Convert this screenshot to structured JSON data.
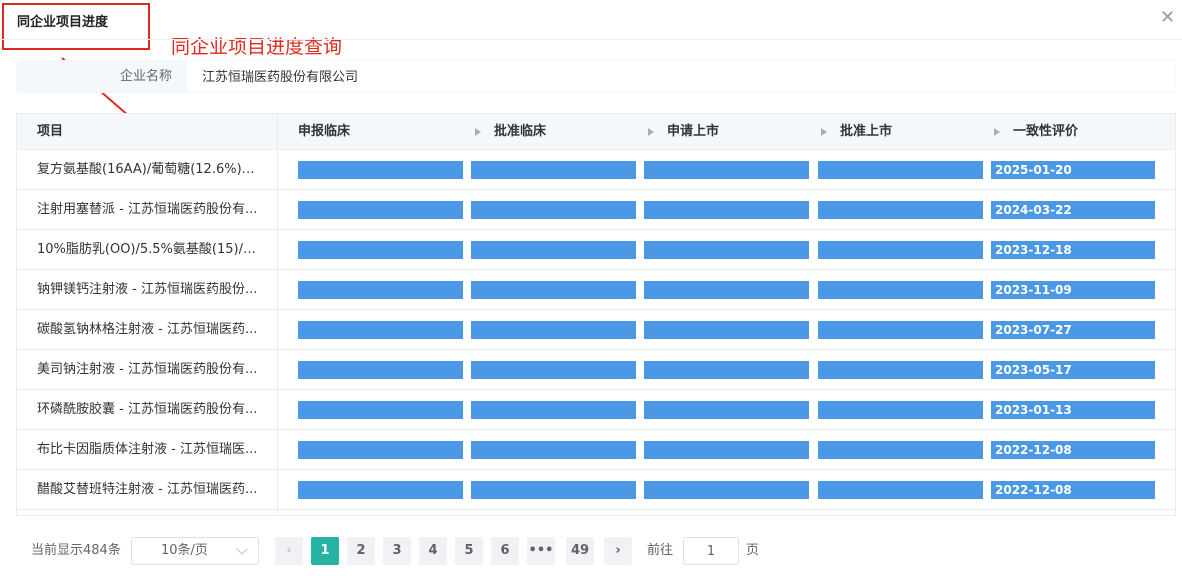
{
  "dialog": {
    "title": "同企业项目进度",
    "close_glyph": "✕",
    "annotation": "同企业项目进度查询"
  },
  "company": {
    "label": "企业名称",
    "value": "江苏恒瑞医药股份有限公司"
  },
  "table": {
    "columns": [
      "项目",
      "申报临床",
      "批准临床",
      "申请上市",
      "批准上市",
      "一致性评价"
    ],
    "rows": [
      {
        "name": "复方氨基酸(16AA)/葡萄糖(12.6%)电...",
        "date": "2025-01-20"
      },
      {
        "name": "注射用塞替派 - 江苏恒瑞医药股份有...",
        "date": "2024-03-22"
      },
      {
        "name": "10%脂肪乳(OO)/5.5%氨基酸(15)/葡...",
        "date": "2023-12-18"
      },
      {
        "name": "钠钾镁钙注射液 - 江苏恒瑞医药股份...",
        "date": "2023-11-09"
      },
      {
        "name": "碳酸氢钠林格注射液 - 江苏恒瑞医药...",
        "date": "2023-07-27"
      },
      {
        "name": "美司钠注射液 - 江苏恒瑞医药股份有...",
        "date": "2023-05-17"
      },
      {
        "name": "环磷酰胺胶囊 - 江苏恒瑞医药股份有...",
        "date": "2023-01-13"
      },
      {
        "name": "布比卡因脂质体注射液 - 江苏恒瑞医...",
        "date": "2022-12-08"
      },
      {
        "name": "醋酸艾替班特注射液 - 江苏恒瑞医药...",
        "date": "2022-12-08"
      }
    ],
    "bar_color": "#4a98e6"
  },
  "pagination": {
    "total_text": "当前显示484条",
    "page_size": "10条/页",
    "prev_glyph": "‹",
    "next_glyph": "›",
    "pages": [
      "1",
      "2",
      "3",
      "4",
      "5",
      "6",
      "•••",
      "49"
    ],
    "current_page": "1",
    "goto_label": "前往",
    "goto_value": "1",
    "page_unit": "页",
    "active_color": "#26b3a6"
  }
}
